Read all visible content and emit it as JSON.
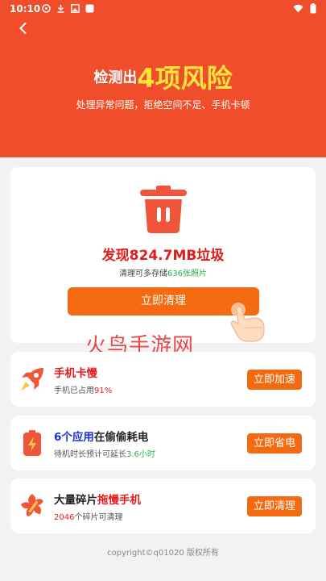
{
  "status": {
    "time": "10:10",
    "icons": [
      "sync-icon",
      "download-icon",
      "image-icon",
      "app-icon"
    ],
    "right_icons": [
      "wifi-icon",
      "battery-icon"
    ]
  },
  "header": {
    "title_prefix": "检测出",
    "title_highlight": "4项风险",
    "subtitle": "处理异常问题，拒绝空间不足、手机卡顿"
  },
  "summary": {
    "found_text": "发现824.7MB垃圾",
    "storage_prefix": "清理可多存储",
    "storage_count": "636张照片",
    "clean_button": "立即清理"
  },
  "watermark": "火鸟手游网",
  "risks": [
    {
      "title_parts": [
        {
          "text": "手机卡慢",
          "color": "red"
        }
      ],
      "sub_prefix": "手机已占用",
      "sub_value": "91%",
      "sub_suffix": "",
      "sub_value_color": "red",
      "button": "立即加速",
      "icon": "rocket-icon"
    },
    {
      "title_parts": [
        {
          "text": "6个应用",
          "color": "blue"
        },
        {
          "text": "在偷偷耗电",
          "color": "dark"
        }
      ],
      "sub_prefix": "待机时长预计可延长",
      "sub_value": "3.6小时",
      "sub_suffix": "",
      "sub_value_color": "green",
      "button": "立即省电",
      "icon": "battery-icon"
    },
    {
      "title_parts": [
        {
          "text": "大量碎片",
          "color": "dark"
        },
        {
          "text": "拖慢手机",
          "color": "red"
        }
      ],
      "sub_prefix": "",
      "sub_value": "2046",
      "sub_suffix": "个碎片可清理",
      "sub_value_color": "red",
      "button": "立即清理",
      "icon": "fragment-icon"
    }
  ],
  "footer": "copyright©q01020 版权所有",
  "colors": {
    "hero": "#f04e2b",
    "accent": "#f46a10",
    "highlight": "#fde33b",
    "red": "#e41b1b",
    "green": "#25b34a",
    "blue": "#1d2fe0"
  }
}
